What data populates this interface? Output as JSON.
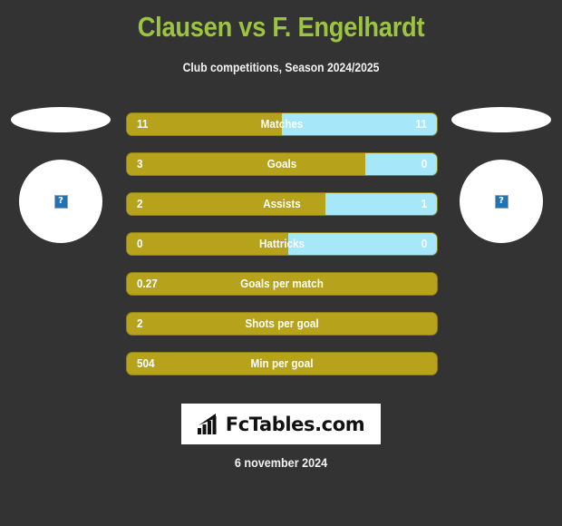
{
  "header": {
    "title": "Clausen vs F. Engelhardt",
    "subtitle": "Club competitions, Season 2024/2025",
    "title_color": "#9dc440"
  },
  "players": {
    "left": {
      "name": "",
      "avatar_icon": "broken-image-icon",
      "placeholder_glyph": "?"
    },
    "right": {
      "name": "",
      "avatar_icon": "broken-image-icon",
      "placeholder_glyph": "?"
    }
  },
  "colors": {
    "background": "#333333",
    "home_bar": "#b6a31b",
    "away_bar": "#a6e7fa",
    "accent_green": "#9dc440",
    "text": "#ffffff"
  },
  "chart_data": {
    "type": "bar",
    "title": "Clausen vs F. Engelhardt",
    "subtitle": "Club competitions, Season 2024/2025",
    "orientation": "horizontal-diverging",
    "legend": [
      "Clausen",
      "F. Engelhardt"
    ],
    "categories": [
      "Matches",
      "Goals",
      "Assists",
      "Hattricks",
      "Goals per match",
      "Shots per goal",
      "Min per goal"
    ],
    "series": [
      {
        "name": "Clausen",
        "color": "#b6a31b",
        "values": [
          11,
          3,
          2,
          0,
          0.27,
          2,
          504
        ]
      },
      {
        "name": "F. Engelhardt",
        "color": "#a6e7fa",
        "values": [
          11,
          0,
          1,
          0,
          null,
          null,
          null
        ]
      }
    ]
  },
  "bars": [
    {
      "label": "Matches",
      "left_value": "11",
      "right_value": "11",
      "fill_percent": 50,
      "two_sided": true
    },
    {
      "label": "Goals",
      "left_value": "3",
      "right_value": "0",
      "fill_percent": 77,
      "two_sided": true
    },
    {
      "label": "Assists",
      "left_value": "2",
      "right_value": "1",
      "fill_percent": 64,
      "two_sided": true
    },
    {
      "label": "Hattricks",
      "left_value": "0",
      "right_value": "0",
      "fill_percent": 52,
      "two_sided": true
    },
    {
      "label": "Goals per match",
      "left_value": "0.27",
      "right_value": "",
      "fill_percent": 100,
      "two_sided": false
    },
    {
      "label": "Shots per goal",
      "left_value": "2",
      "right_value": "",
      "fill_percent": 100,
      "two_sided": false
    },
    {
      "label": "Min per goal",
      "left_value": "504",
      "right_value": "",
      "fill_percent": 100,
      "two_sided": false
    }
  ],
  "footer": {
    "logo_text": "FcTables.com",
    "logo_icon": "bar-chart-arrow-icon",
    "date": "6 november 2024"
  }
}
